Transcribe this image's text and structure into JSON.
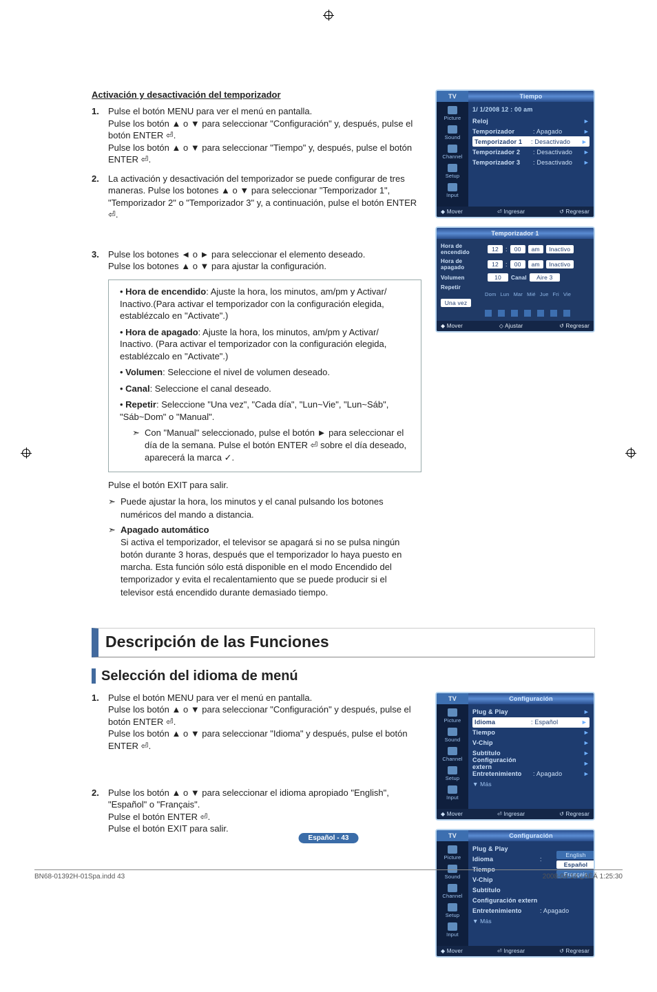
{
  "section_a": {
    "heading": "Activación y desactivación del temporizador",
    "steps": [
      {
        "num": "1.",
        "lines": [
          "Pulse el botón MENU para ver el menú en pantalla.",
          "Pulse los botón ▲ o ▼ para seleccionar \"Configuración\" y, después, pulse el botón ENTER ⏎.",
          "Pulse los botón ▲ o ▼ para seleccionar \"Tiempo\" y, después, pulse el botón ENTER ⏎."
        ]
      },
      {
        "num": "2.",
        "lines": [
          "La activación y desactivación del temporizador se puede configurar de tres maneras. Pulse los botones ▲ o ▼ para seleccionar \"Temporizador 1\", \"Temporizador 2\" o \"Temporizador 3\" y, a continuación, pulse el botón ENTER ⏎."
        ]
      },
      {
        "num": "3.",
        "lines": [
          "Pulse los botones ◄ o ► para seleccionar el elemento deseado.",
          "Pulse los botones ▲ o ▼ para ajustar la configuración."
        ]
      }
    ],
    "box": {
      "items": [
        {
          "label": "Hora de encendido",
          "text": ": Ajuste la hora, los minutos, am/pm y Activar/ Inactivo.(Para activar el temporizador con la configuración elegida, establézcalo en \"Activate\".)"
        },
        {
          "label": "Hora de apagado",
          "text": ": Ajuste la hora, los minutos, am/pm y Activar/ Inactivo. (Para activar el temporizador con la configuración elegida, establézcalo en \"Activate\".)"
        },
        {
          "label": "Volumen",
          "text": ": Seleccione el nivel de volumen deseado."
        },
        {
          "label": "Canal",
          "text": ": Seleccione el canal deseado."
        },
        {
          "label": "Repetir",
          "text": ": Seleccione \"Una vez\", \"Cada día\", \"Lun~Vie\", \"Lun~Sáb\", \"Sáb~Dom\" o \"Manual\"."
        }
      ],
      "manual_note": "Con \"Manual\" seleccionado, pulse el botón ► para seleccionar el día de la semana. Pulse el botón ENTER ⏎ sobre el día deseado, aparecerá la marca ✓."
    },
    "after_exit": "Pulse el botón EXIT para salir.",
    "note1": "Puede ajustar la hora, los minutos y el canal pulsando los botones numéricos del mando a distancia.",
    "note2_title": "Apagado automático",
    "note2_body": "Si activa el temporizador, el televisor se apagará si no se pulsa ningún botón durante 3 horas, después que el temporizador lo haya puesto en marcha. Esta función sólo está disponible en el modo Encendido del temporizador y evita el recalentamiento que se puede producir si el televisor está encendido durante demasiado tiempo."
  },
  "section_b": {
    "big": "Descripción de las Funciones",
    "sub": "Selección del idioma de menú",
    "steps": [
      {
        "num": "1.",
        "lines": [
          "Pulse el botón MENU para ver el menú en pantalla.",
          "Pulse los botón ▲ o ▼ para seleccionar \"Configuración\" y después, pulse el botón ENTER ⏎.",
          "Pulse los botón ▲ o ▼ para seleccionar \"Idioma\" y después, pulse el botón ENTER ⏎."
        ]
      },
      {
        "num": "2.",
        "lines": [
          "Pulse los botón ▲ o ▼ para seleccionar el idioma apropiado \"English\", \"Español\" o \"Français\".",
          "Pulse el botón ENTER ⏎.",
          "Pulse el botón EXIT para salir."
        ]
      }
    ]
  },
  "osd_tiempo": {
    "tv": "TV",
    "title": "Tiempo",
    "date": "1/  1/2008  12 : 00 am",
    "nav": [
      "Picture",
      "Sound",
      "Channel",
      "Setup",
      "Input"
    ],
    "rows": [
      {
        "lab": "Reloj",
        "val": "",
        "chev": "►"
      },
      {
        "lab": "Temporizador",
        "val": ": Apagado",
        "chev": "►"
      },
      {
        "lab": "Temporizador 1",
        "val": ": Desactivado",
        "chev": "►",
        "sel": true
      },
      {
        "lab": "Temporizador 2",
        "val": ": Desactivado",
        "chev": "►"
      },
      {
        "lab": "Temporizador 3",
        "val": ": Desactivado",
        "chev": "►"
      }
    ],
    "footer": [
      "◆ Mover",
      "⏎ Ingresar",
      "↺ Regresar"
    ]
  },
  "osd_tmr1": {
    "title": "Temporizador 1",
    "on": {
      "lbl": "Hora de encendido",
      "h": "12",
      "m": "00",
      "ap": "am",
      "st": "Inactivo"
    },
    "off": {
      "lbl": "Hora de apagado",
      "h": "12",
      "m": "00",
      "ap": "am",
      "st": "Inactivo"
    },
    "vol": {
      "lbl": "Volumen",
      "v": "10",
      "ch_l": "Canal",
      "ch_v": "Aire   3"
    },
    "rep": {
      "lbl": "Repetir",
      "days": [
        "Dom",
        "Lun",
        "Mar",
        "Mié",
        "Jue",
        "Fri",
        "Vie"
      ]
    },
    "once": "Una vez",
    "footer": [
      "◆ Mover",
      "◇ Ajustar",
      "↺ Regresar"
    ]
  },
  "osd_cfg1": {
    "tv": "TV",
    "title": "Configuración",
    "nav": [
      "Picture",
      "Sound",
      "Channel",
      "Setup",
      "Input"
    ],
    "rows": [
      {
        "lab": "Plug & Play",
        "val": "",
        "chev": "►"
      },
      {
        "lab": "Idioma",
        "val": ": Español",
        "chev": "►",
        "sel": true
      },
      {
        "lab": "Tiempo",
        "val": "",
        "chev": "►"
      },
      {
        "lab": "V-Chip",
        "val": "",
        "chev": "►"
      },
      {
        "lab": "Subtítulo",
        "val": "",
        "chev": "►"
      },
      {
        "lab": "Configuración extern",
        "val": "",
        "chev": "►"
      },
      {
        "lab": "Entretenimiento",
        "val": ":  Apagado",
        "chev": "►"
      }
    ],
    "more": "▼ Más",
    "footer": [
      "◆ Mover",
      "⏎ Ingresar",
      "↺ Regresar"
    ]
  },
  "osd_cfg2": {
    "tv": "TV",
    "title": "Configuración",
    "nav": [
      "Picture",
      "Sound",
      "Channel",
      "Setup",
      "Input"
    ],
    "rows": [
      {
        "lab": "Plug & Play",
        "val": "",
        "chev": ""
      },
      {
        "lab": "Idioma",
        "val": ":",
        "chev": ""
      },
      {
        "lab": "Tiempo",
        "val": "",
        "chev": ""
      },
      {
        "lab": "V-Chip",
        "val": "",
        "chev": ""
      },
      {
        "lab": "Subtítulo",
        "val": "",
        "chev": ""
      },
      {
        "lab": "Configuración extern",
        "val": "",
        "chev": ""
      },
      {
        "lab": "Entretenimiento",
        "val": ":  Apagado",
        "chev": ""
      }
    ],
    "more": "▼ Más",
    "dd": [
      "English",
      "Español",
      "Français"
    ],
    "footer": [
      "◆ Mover",
      "⏎ Ingresar",
      "↺ Regresar"
    ]
  },
  "page_footer": {
    "center": "Español - 43",
    "left": "BN68-01392H-01Spa.indd   43",
    "right": "2008-04-14   ¿ÀÈÄ 1:25:30"
  }
}
